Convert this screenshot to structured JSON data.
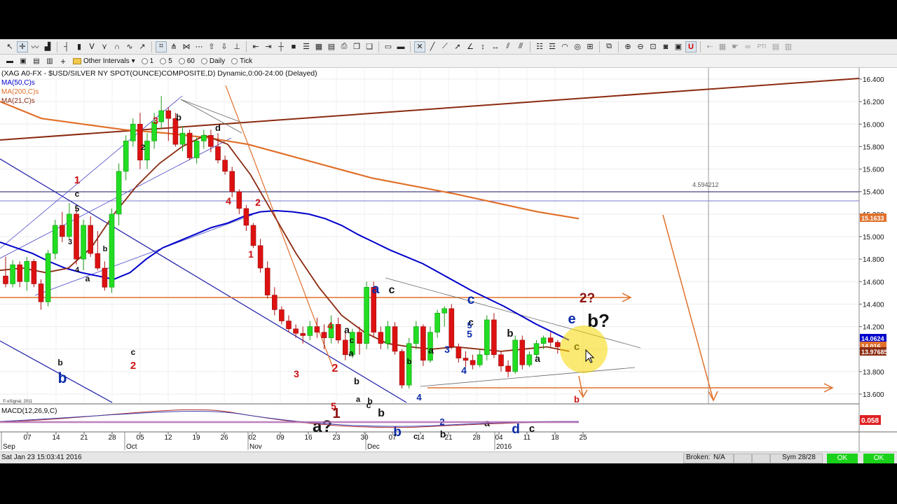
{
  "toolbar2": {
    "interval_label": "Other Intervals",
    "options": [
      "1",
      "5",
      "60",
      "Daily",
      "Tick"
    ]
  },
  "chart_header": {
    "symbol_line": "(XAG A0-FX - $USD/SILVER NY SPOT(OUNCE)COMPOSITE,D) Dynamic,0:00-24:00 (Delayed)",
    "ma50_label": "MA(50,C)s",
    "ma200_label": "MA(200,C)s",
    "ma21_label": "MA(21,C)s",
    "ma50_color": "#0000cc",
    "ma200_color": "#e0702a",
    "ma21_color": "#8b2a10",
    "watermark": "© eSignal, 2011",
    "measure_label": "4.594212",
    "macd_label": "MACD(12,26,9,C)"
  },
  "chart_data": {
    "type": "candlestick",
    "y_axis": {
      "ticks": [
        "16.400",
        "16.200",
        "16.000",
        "15.800",
        "15.600",
        "15.400",
        "15.200",
        "15.000",
        "14.800",
        "14.600",
        "14.400",
        "14.200",
        "14.000",
        "13.800",
        "13.600"
      ],
      "ylim": [
        13.55,
        16.45
      ],
      "price_tags": [
        {
          "label": "15.1633",
          "color": "#e0702a"
        },
        {
          "label": "14.0624",
          "color": "#0000cc"
        },
        {
          "label": "14.016",
          "color": "#e0702a"
        },
        {
          "label": "13.976857",
          "color": "#8b2a10"
        }
      ],
      "macd_tag": {
        "label": "0.058",
        "color": "#e02020"
      }
    },
    "x_axis": {
      "day_ticks": [
        "07",
        "14",
        "21",
        "28",
        "05",
        "12",
        "19",
        "26",
        "02",
        "09",
        "16",
        "23",
        "30",
        "07",
        "14",
        "21",
        "28",
        "04",
        "11",
        "18",
        "25"
      ],
      "month_labels": [
        "Sep",
        "Oct",
        "Nov",
        "Dec",
        "2016"
      ]
    },
    "candles": [
      [
        14.65,
        14.82,
        14.55,
        14.58
      ],
      [
        14.58,
        14.79,
        14.55,
        14.75
      ],
      [
        14.75,
        14.78,
        14.55,
        14.6
      ],
      [
        14.6,
        14.82,
        14.52,
        14.78
      ],
      [
        14.78,
        14.8,
        14.55,
        14.58
      ],
      [
        14.58,
        14.62,
        14.35,
        14.42
      ],
      [
        14.42,
        14.88,
        14.38,
        14.85
      ],
      [
        14.85,
        15.15,
        14.8,
        15.1
      ],
      [
        15.1,
        15.22,
        14.95,
        15.0
      ],
      [
        15.0,
        15.3,
        14.98,
        15.2
      ],
      [
        15.2,
        15.25,
        14.75,
        14.8
      ],
      [
        14.8,
        15.15,
        14.7,
        15.1
      ],
      [
        15.1,
        15.18,
        14.82,
        14.85
      ],
      [
        14.85,
        15.05,
        14.7,
        14.72
      ],
      [
        14.72,
        14.78,
        14.52,
        14.55
      ],
      [
        14.55,
        15.25,
        14.5,
        15.2
      ],
      [
        15.2,
        15.65,
        15.1,
        15.58
      ],
      [
        15.58,
        15.9,
        15.5,
        15.85
      ],
      [
        15.85,
        16.05,
        15.8,
        16.0
      ],
      [
        16.0,
        16.1,
        15.6,
        15.68
      ],
      [
        15.68,
        15.92,
        15.6,
        15.85
      ],
      [
        15.85,
        16.1,
        15.78,
        16.02
      ],
      [
        16.02,
        16.25,
        15.96,
        16.12
      ],
      [
        16.12,
        16.15,
        15.85,
        16.05
      ],
      [
        16.05,
        16.1,
        15.8,
        15.82
      ],
      [
        15.82,
        15.98,
        15.76,
        15.92
      ],
      [
        15.92,
        15.95,
        15.68,
        15.7
      ],
      [
        15.7,
        15.88,
        15.65,
        15.85
      ],
      [
        15.85,
        15.95,
        15.78,
        15.9
      ],
      [
        15.9,
        15.95,
        15.75,
        15.8
      ],
      [
        15.8,
        15.92,
        15.65,
        15.68
      ],
      [
        15.68,
        15.72,
        15.55,
        15.58
      ],
      [
        15.58,
        15.62,
        15.35,
        15.4
      ],
      [
        15.4,
        15.42,
        15.2,
        15.25
      ],
      [
        15.25,
        15.28,
        15.05,
        15.1
      ],
      [
        15.1,
        15.12,
        14.9,
        14.92
      ],
      [
        14.92,
        14.98,
        14.68,
        14.72
      ],
      [
        14.72,
        14.78,
        14.45,
        14.48
      ],
      [
        14.48,
        14.55,
        14.3,
        14.35
      ],
      [
        14.35,
        14.38,
        14.22,
        14.25
      ],
      [
        14.25,
        14.3,
        14.15,
        14.18
      ],
      [
        14.18,
        14.22,
        14.1,
        14.14
      ],
      [
        14.14,
        14.2,
        14.05,
        14.12
      ],
      [
        14.12,
        14.25,
        14.08,
        14.2
      ],
      [
        14.2,
        14.28,
        14.1,
        14.15
      ],
      [
        14.15,
        14.22,
        14.0,
        14.1
      ],
      [
        14.1,
        14.3,
        14.05,
        14.22
      ],
      [
        14.22,
        14.28,
        14.05,
        14.08
      ],
      [
        14.08,
        14.15,
        13.9,
        13.95
      ],
      [
        13.95,
        14.18,
        13.92,
        14.15
      ],
      [
        14.15,
        14.2,
        13.95,
        14.05
      ],
      [
        14.05,
        14.6,
        14.0,
        14.55
      ],
      [
        14.55,
        14.6,
        14.1,
        14.15
      ],
      [
        14.15,
        14.2,
        14.0,
        14.05
      ],
      [
        14.05,
        14.25,
        14.0,
        14.2
      ],
      [
        14.2,
        14.24,
        13.95,
        13.98
      ],
      [
        13.98,
        14.0,
        13.65,
        13.68
      ],
      [
        13.68,
        14.1,
        13.65,
        14.05
      ],
      [
        14.05,
        14.25,
        14.0,
        14.2
      ],
      [
        14.2,
        14.22,
        13.85,
        13.9
      ],
      [
        13.9,
        14.2,
        13.88,
        14.15
      ],
      [
        14.15,
        14.35,
        14.1,
        14.32
      ],
      [
        14.32,
        14.38,
        14.2,
        14.36
      ],
      [
        14.36,
        14.4,
        14.0,
        14.02
      ],
      [
        14.02,
        14.05,
        13.88,
        13.92
      ],
      [
        13.92,
        13.98,
        13.84,
        13.9
      ],
      [
        13.9,
        13.95,
        13.82,
        13.86
      ],
      [
        13.86,
        14.0,
        13.84,
        13.95
      ],
      [
        13.95,
        14.3,
        13.9,
        14.26
      ],
      [
        14.26,
        14.32,
        13.92,
        13.95
      ],
      [
        13.95,
        13.98,
        13.8,
        13.85
      ],
      [
        13.85,
        13.9,
        13.75,
        13.8
      ],
      [
        13.8,
        14.12,
        13.78,
        14.08
      ],
      [
        14.08,
        14.12,
        13.82,
        13.86
      ],
      [
        13.86,
        13.98,
        13.84,
        13.95
      ],
      [
        13.95,
        14.08,
        13.92,
        14.05
      ],
      [
        14.05,
        14.12,
        14.0,
        14.1
      ],
      [
        14.1,
        14.15,
        14.02,
        14.06
      ],
      [
        14.06,
        14.08,
        13.96,
        14.02
      ]
    ],
    "ma50": [
      [
        14.95,
        14.9
      ],
      [
        14.9,
        14.85
      ],
      [
        14.85,
        14.78
      ],
      [
        14.78,
        14.72
      ],
      [
        14.72,
        14.68
      ],
      [
        14.68,
        14.65
      ],
      [
        14.65,
        14.62
      ],
      [
        14.62,
        14.68
      ],
      [
        14.68,
        14.8
      ],
      [
        14.8,
        14.9
      ],
      [
        14.9,
        14.96
      ],
      [
        14.96,
        15.02
      ],
      [
        15.02,
        15.08
      ],
      [
        15.08,
        15.12
      ],
      [
        15.12,
        15.18
      ],
      [
        15.18,
        15.22
      ],
      [
        15.22,
        15.23
      ],
      [
        15.23,
        15.22
      ],
      [
        15.22,
        15.2
      ],
      [
        15.2,
        15.16
      ],
      [
        15.16,
        15.1
      ],
      [
        15.1,
        15.02
      ],
      [
        15.02,
        14.95
      ],
      [
        14.95,
        14.88
      ],
      [
        14.88,
        14.82
      ],
      [
        14.82,
        14.76
      ],
      [
        14.76,
        14.68
      ],
      [
        14.68,
        14.6
      ],
      [
        14.6,
        14.52
      ],
      [
        14.52,
        14.45
      ],
      [
        14.45,
        14.38
      ],
      [
        14.38,
        14.3
      ],
      [
        14.3,
        14.22
      ],
      [
        14.22,
        14.15
      ],
      [
        14.15,
        14.08
      ]
    ],
    "ma200": [
      [
        16.2,
        16.05
      ],
      [
        16.05,
        16.0
      ],
      [
        16.0,
        15.95
      ],
      [
        15.95,
        15.92
      ],
      [
        15.92,
        15.88
      ],
      [
        15.88,
        15.82
      ],
      [
        15.82,
        15.72
      ],
      [
        15.72,
        15.62
      ],
      [
        15.62,
        15.52
      ],
      [
        15.52,
        15.45
      ],
      [
        15.45,
        15.38
      ],
      [
        15.38,
        15.3
      ],
      [
        15.3,
        15.22
      ],
      [
        15.22,
        15.16
      ]
    ],
    "ma21": [
      [
        14.7,
        14.72
      ],
      [
        14.72,
        14.68
      ],
      [
        14.68,
        14.72
      ],
      [
        14.72,
        14.9
      ],
      [
        14.9,
        15.2
      ],
      [
        15.2,
        15.45
      ],
      [
        15.45,
        15.65
      ],
      [
        15.65,
        15.8
      ],
      [
        15.8,
        15.9
      ],
      [
        15.9,
        15.82
      ],
      [
        15.82,
        15.55
      ],
      [
        15.55,
        15.2
      ],
      [
        15.2,
        14.85
      ],
      [
        14.85,
        14.55
      ],
      [
        14.55,
        14.3
      ],
      [
        14.3,
        14.15
      ],
      [
        14.15,
        14.05
      ],
      [
        14.05,
        14.02
      ],
      [
        14.02,
        14.0
      ],
      [
        14.0,
        14.02
      ],
      [
        14.02,
        14.0
      ],
      [
        14.0,
        13.98
      ],
      [
        13.98,
        14.0
      ],
      [
        14.0,
        14.02
      ],
      [
        14.02,
        13.98
      ]
    ],
    "wave_labels": [
      {
        "t": "3",
        "c": "#cc1111",
        "s": 14
      },
      {
        "t": "b",
        "c": "#111111",
        "s": 13
      },
      {
        "t": "d",
        "c": "#111111",
        "s": 13
      },
      {
        "t": "1",
        "c": "#cc1111",
        "s": 15
      },
      {
        "t": "c",
        "c": "#111111",
        "s": 12
      },
      {
        "t": "5",
        "c": "#111111",
        "s": 12
      },
      {
        "t": "2",
        "c": "#111111",
        "s": 11
      },
      {
        "t": "4",
        "c": "#cc1111",
        "s": 14
      },
      {
        "t": "2",
        "c": "#cc1111",
        "s": 14
      },
      {
        "t": "1",
        "c": "#cc1111",
        "s": 14
      },
      {
        "t": "a",
        "c": "#0a2aa8",
        "s": 19
      },
      {
        "t": "c",
        "c": "#111111",
        "s": 16
      },
      {
        "t": "c",
        "c": "#0a2aa8",
        "s": 19
      },
      {
        "t": "c",
        "c": "#111111",
        "s": 14
      },
      {
        "t": "5",
        "c": "#0a2aa8",
        "s": 14
      },
      {
        "t": "b",
        "c": "#111111",
        "s": 15
      },
      {
        "t": "e",
        "c": "#0a2aa8",
        "s": 20
      },
      {
        "t": "b?",
        "c": "#111111",
        "s": 26
      },
      {
        "t": "2?",
        "c": "#8b1010",
        "s": 19
      },
      {
        "t": "c",
        "c": "#111111",
        "s": 15
      },
      {
        "t": "a",
        "c": "#111111",
        "s": 14
      },
      {
        "t": "b",
        "c": "#0a2aa8",
        "s": 21
      },
      {
        "t": "2",
        "c": "#cc1111",
        "s": 15
      },
      {
        "t": "b",
        "c": "#111111",
        "s": 12
      },
      {
        "t": "c",
        "c": "#111111",
        "s": 12
      },
      {
        "t": "2",
        "c": "#cc1111",
        "s": 16
      },
      {
        "t": "4",
        "c": "#cc1111",
        "s": 14
      },
      {
        "t": "3",
        "c": "#cc1111",
        "s": 14
      },
      {
        "t": "5",
        "c": "#cc1111",
        "s": 14
      },
      {
        "t": "a?",
        "c": "#111111",
        "s": 24
      },
      {
        "t": "1",
        "c": "#8b1010",
        "s": 20
      },
      {
        "t": "b",
        "c": "#111111",
        "s": 16
      },
      {
        "t": "b",
        "c": "#0a2aa8",
        "s": 19
      },
      {
        "t": "c",
        "c": "#111111",
        "s": 11
      },
      {
        "t": "5",
        "c": "#0a2aa8",
        "s": 12
      },
      {
        "t": "2",
        "c": "#0a2aa8",
        "s": 13
      },
      {
        "t": "b",
        "c": "#111111",
        "s": 14
      },
      {
        "t": "a",
        "c": "#111111",
        "s": 14
      },
      {
        "t": "d",
        "c": "#0a2aa8",
        "s": 19
      },
      {
        "t": "c",
        "c": "#111111",
        "s": 15
      },
      {
        "t": "3",
        "c": "#0a2aa8",
        "s": 14
      },
      {
        "t": "4",
        "c": "#0a2aa8",
        "s": 14
      },
      {
        "t": "4",
        "c": "#0a2aa8",
        "s": 13
      },
      {
        "t": "a",
        "c": "#111111",
        "s": 14
      },
      {
        "t": "a",
        "c": "#111111",
        "s": 14
      },
      {
        "t": "a",
        "c": "#111111",
        "s": 13
      },
      {
        "t": "b",
        "c": "#111111",
        "s": 13
      },
      {
        "t": "a",
        "c": "#111111",
        "s": 11
      },
      {
        "t": "b",
        "c": "#111111",
        "s": 12
      },
      {
        "t": "c",
        "c": "#111111",
        "s": 12
      },
      {
        "t": "c",
        "c": "#111111",
        "s": 12
      },
      {
        "t": "3",
        "c": "#111111",
        "s": 11
      },
      {
        "t": "4",
        "c": "#111111",
        "s": 11
      },
      {
        "t": "a",
        "c": "#111111",
        "s": 12
      },
      {
        "t": "b",
        "c": "#111111",
        "s": 11
      },
      {
        "t": "b",
        "c": "#111111",
        "s": 11
      },
      {
        "t": "b",
        "c": "#cc1111",
        "s": 13
      }
    ]
  },
  "status": {
    "datetime": "Sat Jan 23 15:03:41 2016",
    "broken_label": "Broken:",
    "broken_value": "N/A",
    "sym_label": "Sym 28/28",
    "ok1": "OK",
    "ok2": "OK",
    "ok_color": "#1bd21b"
  }
}
